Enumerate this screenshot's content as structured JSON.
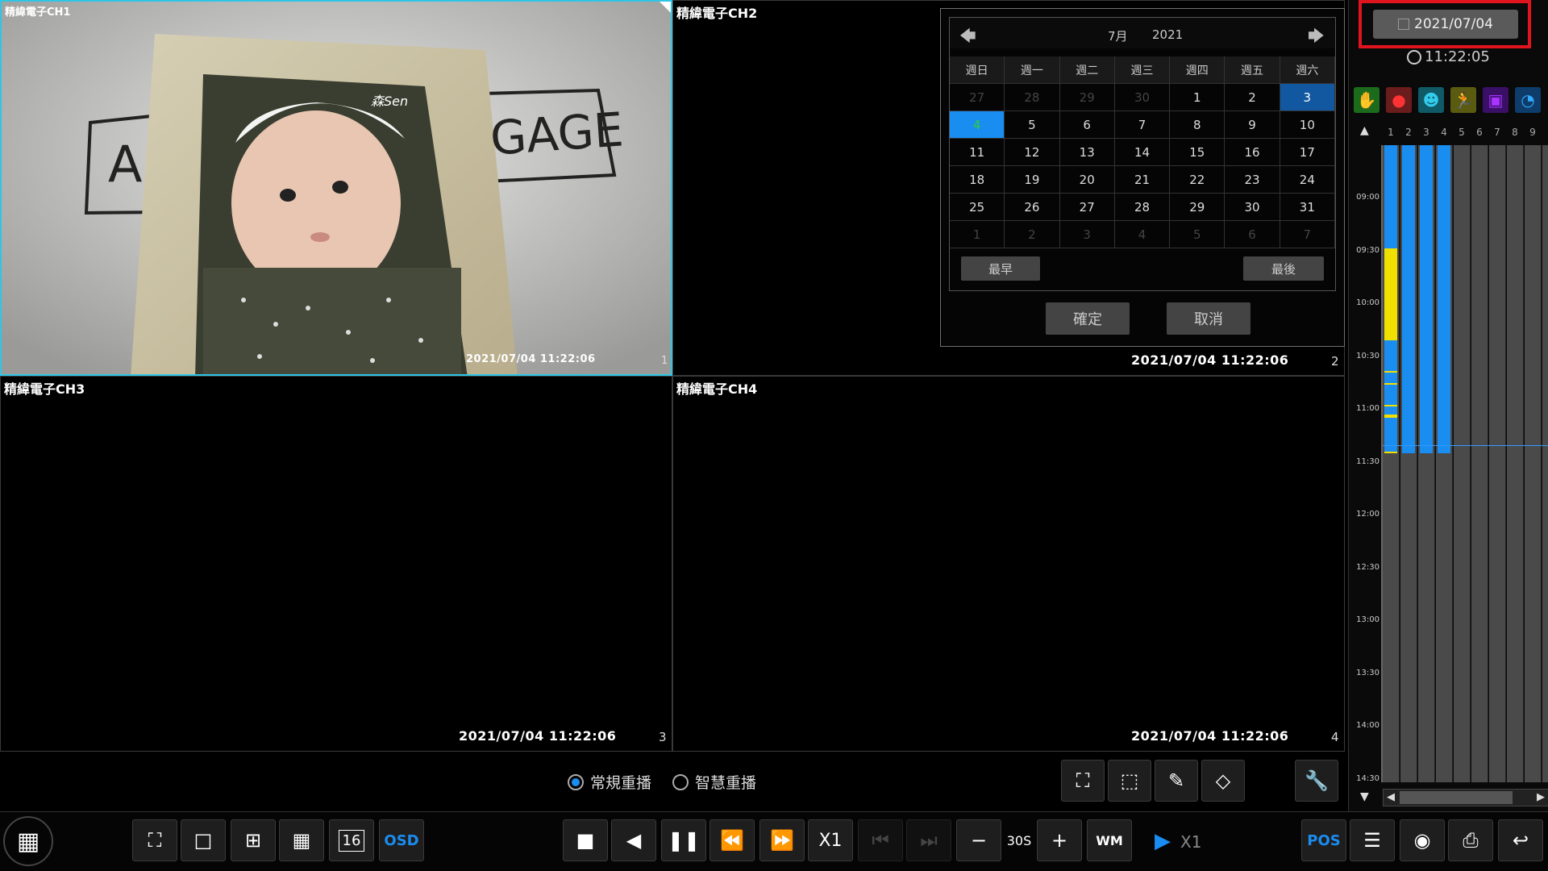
{
  "channels": [
    {
      "label": "精緯電子CH1",
      "timestamp": "2021/07/04 11:22:06",
      "number": "1"
    },
    {
      "label": "精緯電子CH2",
      "timestamp": "2021/07/04 11:22:06",
      "number": "2"
    },
    {
      "label": "精緯電子CH3",
      "timestamp": "2021/07/04 11:22:06",
      "number": "3"
    },
    {
      "label": "精緯電子CH4",
      "timestamp": "2021/07/04 11:22:06",
      "number": "4"
    }
  ],
  "photo_text": {
    "left_letter": "A",
    "right_word": "GAGE",
    "signature": "森Sen"
  },
  "calendar": {
    "month": "7月",
    "year": "2021",
    "weekdays": [
      "週日",
      "週一",
      "週二",
      "週三",
      "週四",
      "週五",
      "週六"
    ],
    "weeks": [
      [
        "27",
        "28",
        "29",
        "30",
        "1",
        "2",
        "3"
      ],
      [
        "4",
        "5",
        "6",
        "7",
        "8",
        "9",
        "10"
      ],
      [
        "11",
        "12",
        "13",
        "14",
        "15",
        "16",
        "17"
      ],
      [
        "18",
        "19",
        "20",
        "21",
        "22",
        "23",
        "24"
      ],
      [
        "25",
        "26",
        "27",
        "28",
        "29",
        "30",
        "31"
      ],
      [
        "1",
        "2",
        "3",
        "4",
        "5",
        "6",
        "7"
      ]
    ],
    "earliest_label": "最早",
    "latest_label": "最後",
    "confirm_label": "確定",
    "cancel_label": "取消"
  },
  "date_selector": {
    "value": "2021/07/04",
    "time": "11:22:05",
    "highlight_color": "#e0141e"
  },
  "timeline": {
    "channel_numbers": [
      "1",
      "2",
      "3",
      "4",
      "5",
      "6",
      "7",
      "8",
      "9",
      "1"
    ],
    "times": [
      "09:00",
      "09:30",
      "10:00",
      "10:30",
      "11:00",
      "11:30",
      "12:00",
      "12:30",
      "13:00",
      "13:30",
      "14:00",
      "14:30"
    ],
    "record_color_normal": "#1a8df0",
    "record_color_event": "#f0e000"
  },
  "playback_modes": {
    "normal": "常規重播",
    "smart": "智慧重播"
  },
  "toolbar": {
    "osd_label": "OSD",
    "speed_label": "X1",
    "step_label": "30S",
    "play_speed": "X1",
    "pos_label": "POS",
    "layout16_label": "16"
  },
  "event_icons": [
    "hand-icon",
    "person-alarm-icon",
    "face-icon",
    "motion-run-icon",
    "person-detect-icon",
    "pie-icon"
  ]
}
